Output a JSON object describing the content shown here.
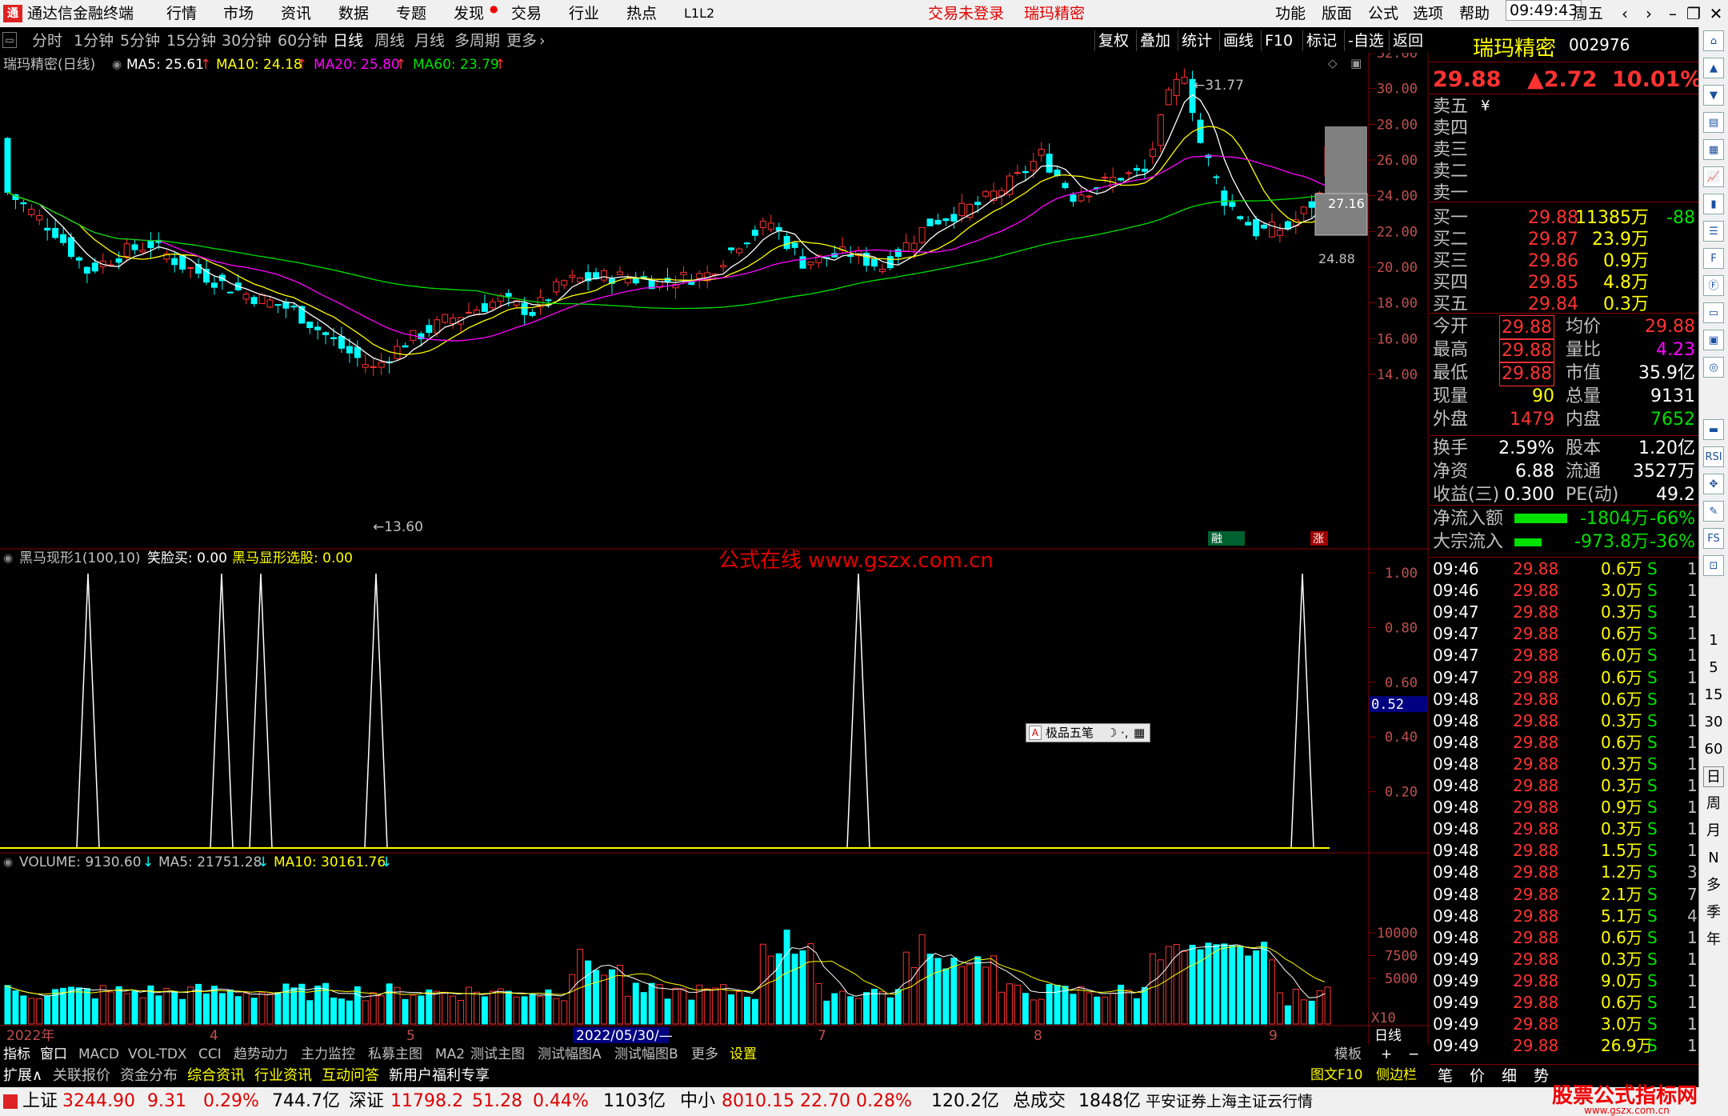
{
  "app": {
    "title": "通达信金融终端",
    "menus": [
      "行情",
      "市场",
      "资讯",
      "数据",
      "专题",
      "发现",
      "交易",
      "行业",
      "热点",
      "L1L2"
    ],
    "center_left": "交易未登录",
    "center_right": "瑞玛精密",
    "right_menus": [
      "功能",
      "版面",
      "公式",
      "选项",
      "帮助"
    ],
    "clock": "09:49:43",
    "weekday": "周五"
  },
  "periods": [
    "分时",
    "1分钟",
    "5分钟",
    "15分钟",
    "30分钟",
    "60分钟",
    "日线",
    "周线",
    "月线",
    "多周期",
    "更多"
  ],
  "active_period": "日线",
  "chart_ops": [
    "复权",
    "叠加",
    "统计",
    "画线",
    "F10",
    "标记",
    "-自选",
    "返回"
  ],
  "ma_bar": {
    "label": "瑞玛精密(日线)",
    "ma5": "MA5: 25.61",
    "ma10": "MA10: 24.18",
    "ma20": "MA20: 25.80",
    "ma60": "MA60: 23.79",
    "arrow": "↑"
  },
  "indicator_bar": {
    "name": "黑马现形1(100,10)",
    "item1": "笑脸买: 0.00",
    "item2": "黑马显形选股: 0.00"
  },
  "watermark": "公式在线 www.gszx.com.cn",
  "volume_bar": {
    "v": "VOLUME: 9130.60",
    "ma5": "MA5: 21751.28",
    "ma10": "MA10: 30161.76",
    "arrow": "↓"
  },
  "float_toolbar": {
    "label": "极品五笔"
  },
  "price_axis": [
    "32.00",
    "30.00",
    "28.00",
    "26.00",
    "24.00",
    "22.00",
    "20.00",
    "18.00",
    "16.00",
    "14.00"
  ],
  "ind_axis": [
    "1.00",
    "0.80",
    "0.60",
    "0.40",
    "0.20"
  ],
  "ind_cursor": "0.52",
  "vol_axis": [
    "10000",
    "7500",
    "5000"
  ],
  "vol_unit": "X10",
  "annotations": {
    "high": "31.77",
    "low": "13.60",
    "box": "27.16",
    "cur": "24.88"
  },
  "markers": {
    "m1": "融",
    "m2": "涨"
  },
  "date_axis": [
    "2022年",
    "4",
    "5",
    "2022/05/30/—",
    "7",
    "8",
    "9"
  ],
  "date_period": "日线",
  "bottom_tabs": [
    "指标",
    "窗口",
    "MACD",
    "VOL-TDX",
    "CCI",
    "趋势动力",
    "主力监控",
    "私募主图",
    "MA2",
    "测试主图",
    "测试幅图A",
    "测试幅图B",
    "更多",
    "设置"
  ],
  "bottom_tabs2": [
    "扩展∧",
    "关联报价",
    "资金分布",
    "综合资讯",
    "行业资讯",
    "互动问答",
    "新用户福利专享"
  ],
  "bottom_right": [
    "模板",
    "+",
    "−"
  ],
  "right_bottom": [
    "图文F10",
    "侧边栏《"
  ],
  "right_tabs": [
    "笔",
    "价",
    "细",
    "势"
  ],
  "stock": {
    "name": "瑞玛精密",
    "code": "002976",
    "price": "29.88",
    "change": "▲2.72",
    "pct": "10.01%"
  },
  "sells": [
    {
      "l": "卖五",
      "p": "",
      "v": "",
      "c": ""
    },
    {
      "l": "卖四",
      "p": "",
      "v": "",
      "c": ""
    },
    {
      "l": "卖三",
      "p": "",
      "v": "",
      "c": ""
    },
    {
      "l": "卖二",
      "p": "",
      "v": "",
      "c": ""
    },
    {
      "l": "卖一",
      "p": "",
      "v": "",
      "c": ""
    }
  ],
  "sell_mark": "¥",
  "buys": [
    {
      "l": "买一",
      "p": "29.88",
      "v": "11385万",
      "c": "-88"
    },
    {
      "l": "买二",
      "p": "29.87",
      "v": "23.9万",
      "c": ""
    },
    {
      "l": "买三",
      "p": "29.86",
      "v": "0.9万",
      "c": ""
    },
    {
      "l": "买四",
      "p": "29.85",
      "v": "4.8万",
      "c": ""
    },
    {
      "l": "买五",
      "p": "29.84",
      "v": "0.3万",
      "c": ""
    }
  ],
  "quote": [
    {
      "l": "今开",
      "v": "29.88",
      "l2": "均价",
      "v2": "29.88"
    },
    {
      "l": "最高",
      "v": "29.88",
      "l2": "量比",
      "v2": "4.23"
    },
    {
      "l": "最低",
      "v": "29.88",
      "l2": "市值",
      "v2": "35.9亿"
    },
    {
      "l": "现量",
      "v": "90",
      "l2": "总量",
      "v2": "9131"
    },
    {
      "l": "外盘",
      "v": "1479",
      "l2": "内盘",
      "v2": "7652"
    }
  ],
  "quote2": [
    {
      "l": "换手",
      "v": "2.59%",
      "l2": "股本",
      "v2": "1.20亿"
    },
    {
      "l": "净资",
      "v": "6.88",
      "l2": "流通",
      "v2": "3527万"
    },
    {
      "l": "收益(三)",
      "v": "0.300",
      "l2": "PE(动)",
      "v2": "49.2"
    }
  ],
  "flows": [
    {
      "l": "净流入额",
      "v": "-1804万",
      "p": "-66%"
    },
    {
      "l": "大宗流入",
      "v": "-973.8万",
      "p": "-36%"
    }
  ],
  "ticks": [
    [
      "09:46",
      "29.88",
      "0.6万",
      "S",
      "1"
    ],
    [
      "09:46",
      "29.88",
      "3.0万",
      "S",
      "1"
    ],
    [
      "09:47",
      "29.88",
      "0.3万",
      "S",
      "1"
    ],
    [
      "09:47",
      "29.88",
      "0.6万",
      "S",
      "1"
    ],
    [
      "09:47",
      "29.88",
      "6.0万",
      "S",
      "1"
    ],
    [
      "09:47",
      "29.88",
      "0.6万",
      "S",
      "1"
    ],
    [
      "09:48",
      "29.88",
      "0.6万",
      "S",
      "1"
    ],
    [
      "09:48",
      "29.88",
      "0.3万",
      "S",
      "1"
    ],
    [
      "09:48",
      "29.88",
      "0.6万",
      "S",
      "1"
    ],
    [
      "09:48",
      "29.88",
      "0.3万",
      "S",
      "1"
    ],
    [
      "09:48",
      "29.88",
      "0.3万",
      "S",
      "1"
    ],
    [
      "09:48",
      "29.88",
      "0.9万",
      "S",
      "1"
    ],
    [
      "09:48",
      "29.88",
      "0.3万",
      "S",
      "1"
    ],
    [
      "09:48",
      "29.88",
      "1.5万",
      "S",
      "1"
    ],
    [
      "09:48",
      "29.88",
      "1.2万",
      "S",
      "3"
    ],
    [
      "09:48",
      "29.88",
      "2.1万",
      "S",
      "7"
    ],
    [
      "09:48",
      "29.88",
      "5.1万",
      "S",
      "4"
    ],
    [
      "09:48",
      "29.88",
      "0.6万",
      "S",
      "1"
    ],
    [
      "09:49",
      "29.88",
      "0.3万",
      "S",
      "1"
    ],
    [
      "09:49",
      "29.88",
      "9.0万",
      "S",
      "1"
    ],
    [
      "09:49",
      "29.88",
      "0.6万",
      "S",
      "1"
    ],
    [
      "09:49",
      "29.88",
      "3.0万",
      "S",
      "1"
    ],
    [
      "09:49",
      "29.88",
      "26.9万",
      "S",
      "1"
    ]
  ],
  "toolbar_icons": [
    "home-icon",
    "up-icon",
    "down-icon",
    "chart-icon",
    "table-icon",
    "line-icon",
    "candle-icon",
    "list-icon",
    "fin-icon",
    "f10-icon",
    "doc-icon",
    "fs-icon",
    "cycle-icon"
  ],
  "period_side": [
    "日",
    "周",
    "月",
    "N",
    "多",
    "季",
    "年"
  ],
  "minute_side": [
    "1",
    "5",
    "15",
    "30",
    "60"
  ],
  "status": {
    "sh_l": "上证",
    "sh": "3244.90",
    "sh_c": "9.31",
    "sh_p": "0.29%",
    "sh_v": "744.7亿",
    "sz_l": "深证",
    "sz": "11798.2",
    "sz_c": "51.28",
    "sz_p": "0.44%",
    "sz_v": "1103亿",
    "zx_l": "中小",
    "zx": "8010.15",
    "zx_c": "22.70",
    "zx_p": "0.28%",
    "zx_v": "120.2亿",
    "tot_l": "总成交",
    "tot": "1848亿",
    "broker": "平安证券上海主证云行情",
    "brand": "股票公式指标网",
    "brand_url": "www.gszx.com.cn"
  }
}
